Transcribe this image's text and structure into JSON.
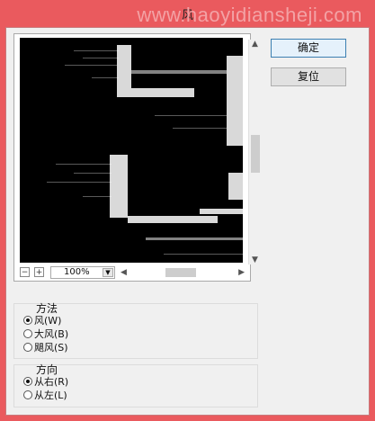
{
  "window": {
    "title": "风",
    "watermark": "www.haoyidiansheji.com"
  },
  "buttons": {
    "ok": "确定",
    "reset": "复位"
  },
  "preview": {
    "zoom": "100%",
    "zoom_out": "−",
    "zoom_in": "+"
  },
  "method": {
    "title": "方法",
    "options": [
      {
        "label": "风(W)",
        "selected": true
      },
      {
        "label": "大风(B)",
        "selected": false
      },
      {
        "label": "飓风(S)",
        "selected": false
      }
    ]
  },
  "direction": {
    "title": "方向",
    "options": [
      {
        "label": "从右(R)",
        "selected": true
      },
      {
        "label": "从左(L)",
        "selected": false
      }
    ]
  }
}
